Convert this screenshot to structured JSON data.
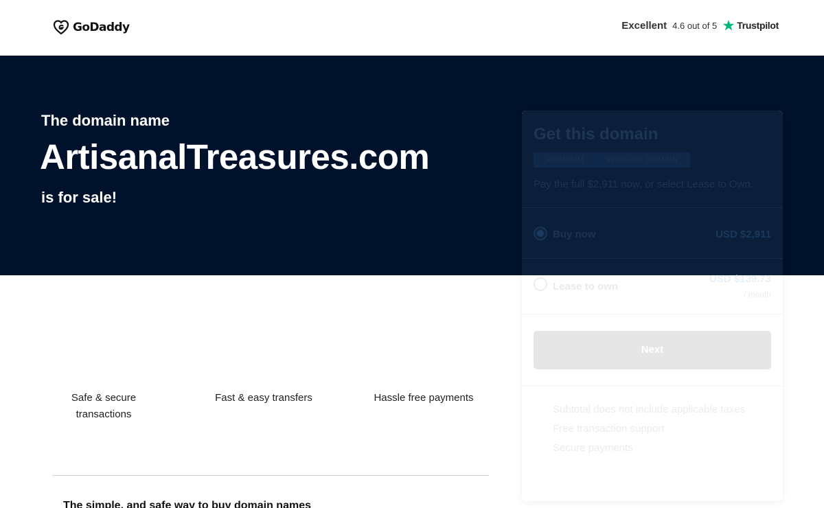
{
  "header": {
    "logo_text": "GoDaddy",
    "rating_word": "Excellent",
    "rating_score": "4.6 out of 5",
    "trustpilot_label": "Trustpilot"
  },
  "hero": {
    "pre": "The domain name",
    "domain": "ArtisanalTreasures.com",
    "post": "is for sale!"
  },
  "features": [
    {
      "label": "Safe & secure transactions"
    },
    {
      "label": "Fast & easy transfers"
    },
    {
      "label": "Hassle free payments"
    }
  ],
  "bottom_heading": "The simple, and safe way to buy domain names",
  "card": {
    "title": "Get this domain",
    "badges": [
      "PREMIUM",
      "VERIFIED DOMAIN"
    ],
    "subtitle": "Pay the full $2,911 now, or select Lease to Own.",
    "options": [
      {
        "label": "Buy now",
        "price": "USD $2,911",
        "selected": true
      },
      {
        "label": "Lease to own",
        "price": "USD $139.73",
        "period": "/ month",
        "selected": false
      }
    ],
    "next_label": "Next",
    "info": [
      "Subtotal does not include applicable taxes",
      "Free transaction support",
      "Secure payments"
    ]
  },
  "colors": {
    "hero_bg": "#00112c",
    "trustpilot_green": "#00b67a"
  }
}
